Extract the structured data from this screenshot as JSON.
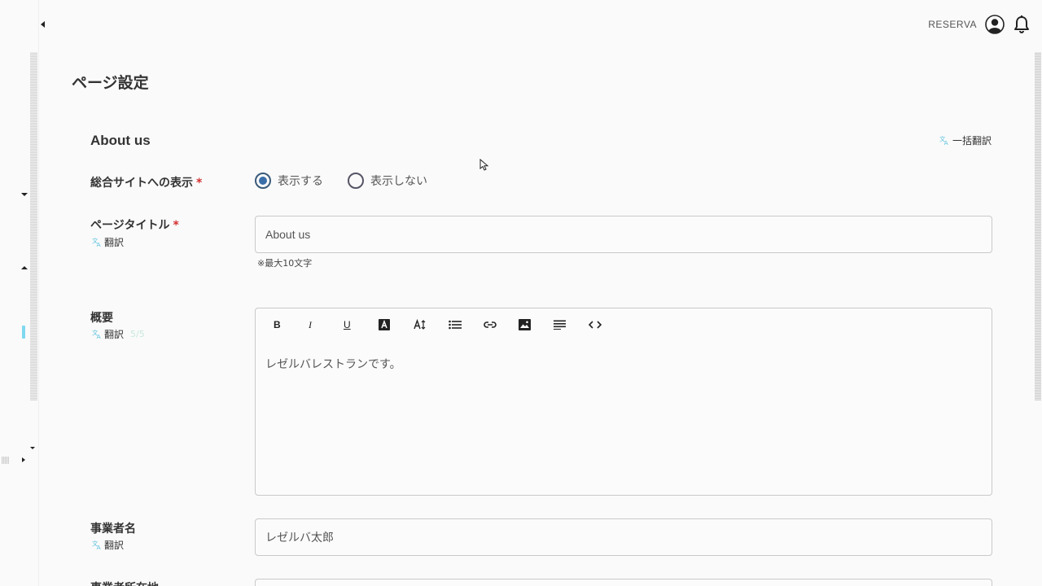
{
  "header": {
    "user_name": "RESERVA"
  },
  "page": {
    "title": "ページ設定"
  },
  "section": {
    "title": "About us",
    "bulk_translate_label": "一括翻訳"
  },
  "fields": {
    "site_display": {
      "label": "総合サイトへの表示",
      "required_mark": "*",
      "options": [
        {
          "label": "表示する",
          "checked": true
        },
        {
          "label": "表示しない",
          "checked": false
        }
      ]
    },
    "page_title": {
      "label": "ページタイトル",
      "required_mark": "*",
      "translate_label": "翻訳",
      "value": "About us",
      "hint": "※最大10文字"
    },
    "overview": {
      "label": "概要",
      "translate_label": "翻訳",
      "counter": "5/5",
      "content": "レゼルバレストランです。",
      "toolbar": [
        "bold",
        "italic",
        "underline",
        "text-color",
        "font-size",
        "bullet-list",
        "link",
        "image",
        "align",
        "code"
      ],
      "toolbar_labels": {
        "bold": "B",
        "italic": "I",
        "underline": "U"
      }
    },
    "business_name": {
      "label": "事業者名",
      "translate_label": "翻訳",
      "value": "レゼルバ太郎"
    },
    "business_address": {
      "label": "事業者所在地"
    }
  },
  "colors": {
    "accent": "#3a6ea8",
    "required": "#d32f2f",
    "translate_icon": "#5bc0de"
  }
}
